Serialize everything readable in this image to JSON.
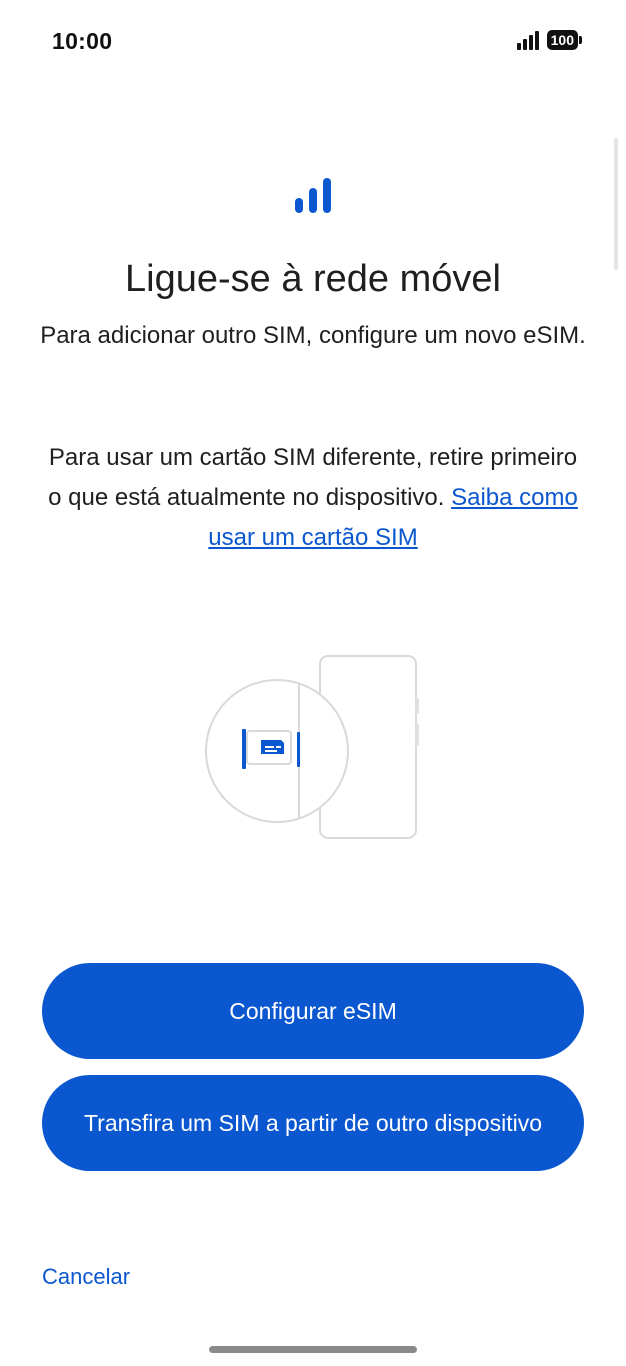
{
  "status_bar": {
    "time": "10:00",
    "battery": "100",
    "signal_icon": "cellular-signal-icon"
  },
  "hero": {
    "icon": "signal-bars-icon",
    "title": "Ligue-se à rede móvel",
    "paragraph_1": "Para adicionar outro SIM, configure um novo eSIM.",
    "paragraph_2": "Para usar um cartão SIM diferente, retire primeiro o que está atualmente no dispositivo.",
    "link": "Saiba como usar um cartão SIM"
  },
  "illustration": {
    "icon": "sim-tray-illustration"
  },
  "actions": {
    "setup_esim": "Configurar eSIM",
    "transfer_sim": "Transfira um SIM a partir de outro dispositivo",
    "cancel": "Cancelar"
  },
  "colors": {
    "accent": "#0b57d0",
    "text": "#1f1f1f",
    "background": "#ffffff"
  }
}
